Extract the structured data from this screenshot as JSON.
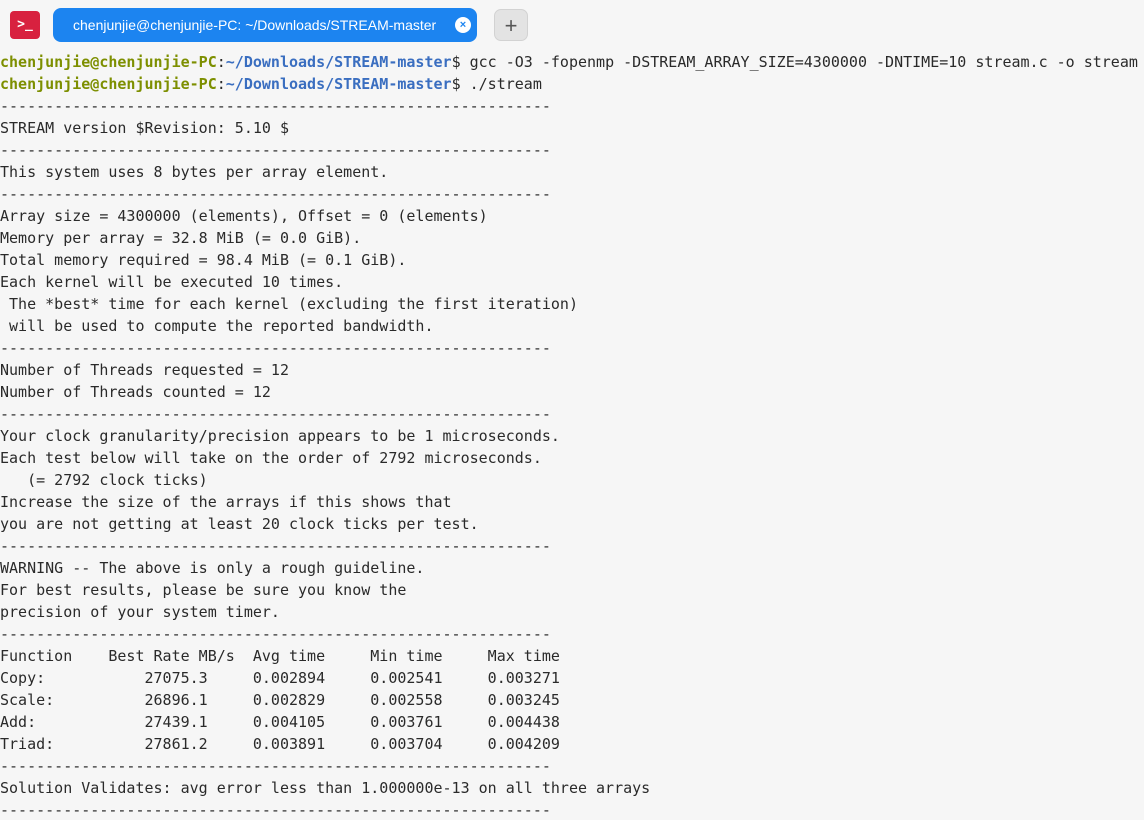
{
  "window": {
    "app_icon_glyph": ">_",
    "tab_title": "chenjunjie@chenjunjie-PC: ~/Downloads/STREAM-master",
    "tab_close_glyph": "×",
    "new_tab_glyph": "+"
  },
  "prompt": {
    "user_host": "chenjunjie@chenjunjie-PC",
    "colon": ":",
    "path": "~/Downloads/STREAM-master",
    "symbol": "$ "
  },
  "commands": [
    "gcc -O3 -fopenmp -DSTREAM_ARRAY_SIZE=4300000 -DNTIME=10 stream.c -o stream",
    "./stream"
  ],
  "output_lines": [
    "-------------------------------------------------------------",
    "STREAM version $Revision: 5.10 $",
    "-------------------------------------------------------------",
    "This system uses 8 bytes per array element.",
    "-------------------------------------------------------------",
    "Array size = 4300000 (elements), Offset = 0 (elements)",
    "Memory per array = 32.8 MiB (= 0.0 GiB).",
    "Total memory required = 98.4 MiB (= 0.1 GiB).",
    "Each kernel will be executed 10 times.",
    " The *best* time for each kernel (excluding the first iteration)",
    " will be used to compute the reported bandwidth.",
    "-------------------------------------------------------------",
    "Number of Threads requested = 12",
    "Number of Threads counted = 12",
    "-------------------------------------------------------------",
    "Your clock granularity/precision appears to be 1 microseconds.",
    "Each test below will take on the order of 2792 microseconds.",
    "   (= 2792 clock ticks)",
    "Increase the size of the arrays if this shows that",
    "you are not getting at least 20 clock ticks per test.",
    "-------------------------------------------------------------",
    "WARNING -- The above is only a rough guideline.",
    "For best results, please be sure you know the",
    "precision of your system timer.",
    "-------------------------------------------------------------",
    "Function    Best Rate MB/s  Avg time     Min time     Max time",
    "Copy:           27075.3     0.002894     0.002541     0.003271",
    "Scale:          26896.1     0.002829     0.002558     0.003245",
    "Add:            27439.1     0.004105     0.003761     0.004438",
    "Triad:          27861.2     0.003891     0.003704     0.004209",
    "-------------------------------------------------------------",
    "Solution Validates: avg error less than 1.000000e-13 on all three arrays",
    "-------------------------------------------------------------"
  ],
  "colors": {
    "user_host": "#7d8f00",
    "path": "#3a6ec0",
    "tab_active": "#1c84f0",
    "app_icon": "#d8213f"
  }
}
